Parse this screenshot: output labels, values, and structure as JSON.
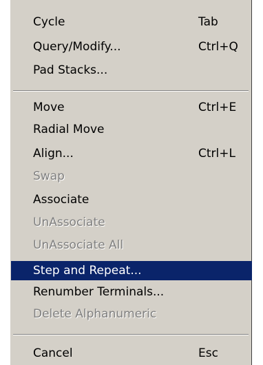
{
  "menu": {
    "items": [
      {
        "label": "Cycle",
        "shortcut": "Tab",
        "state": "normal"
      },
      {
        "label": "Query/Modify...",
        "shortcut": "Ctrl+Q",
        "state": "normal"
      },
      {
        "label": "Pad Stacks...",
        "shortcut": "",
        "state": "normal"
      },
      {
        "label": "Move",
        "shortcut": "Ctrl+E",
        "state": "normal"
      },
      {
        "label": "Radial Move",
        "shortcut": "",
        "state": "normal"
      },
      {
        "label": "Align...",
        "shortcut": "Ctrl+L",
        "state": "normal"
      },
      {
        "label": "Swap",
        "shortcut": "",
        "state": "disabled"
      },
      {
        "label": "Associate",
        "shortcut": "",
        "state": "normal"
      },
      {
        "label": "UnAssociate",
        "shortcut": "",
        "state": "disabled"
      },
      {
        "label": "UnAssociate All",
        "shortcut": "",
        "state": "disabled"
      },
      {
        "label": "Step and Repeat...",
        "shortcut": "",
        "state": "highlighted"
      },
      {
        "label": "Renumber Terminals...",
        "shortcut": "",
        "state": "normal"
      },
      {
        "label": "Delete Alphanumeric",
        "shortcut": "",
        "state": "disabled"
      },
      {
        "label": "Cancel",
        "shortcut": "Esc",
        "state": "normal"
      }
    ]
  },
  "colors": {
    "menu_background": "#d4d0c8",
    "highlight": "#0a246a",
    "disabled_text": "#808080"
  }
}
